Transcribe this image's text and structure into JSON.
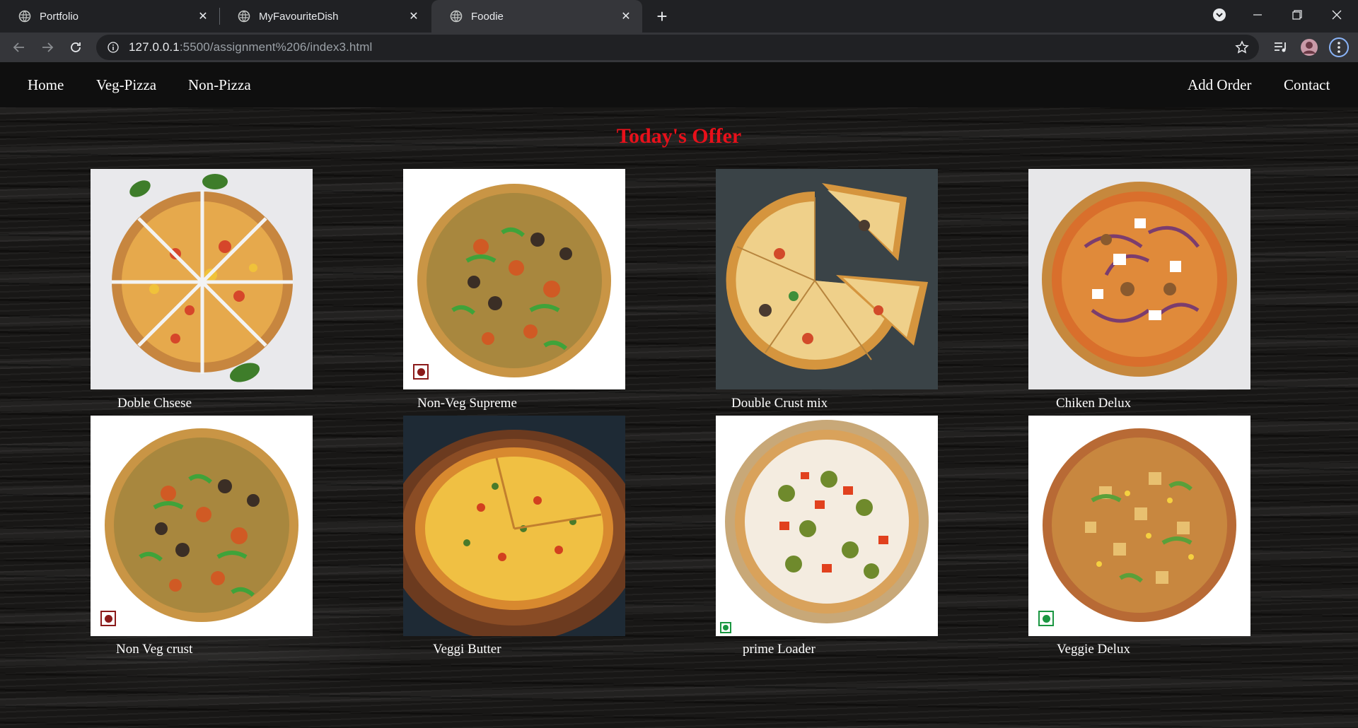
{
  "browser": {
    "tabs": [
      {
        "title": "Portfolio"
      },
      {
        "title": "MyFavouriteDish"
      },
      {
        "title": "Foodie"
      }
    ],
    "address": {
      "host": "127.0.0.1",
      "rest": ":5500/assignment%206/index3.html"
    }
  },
  "nav": {
    "left": [
      "Home",
      "Veg-Pizza",
      "Non-Pizza"
    ],
    "right": [
      "Add Order",
      "Contact"
    ]
  },
  "offer_title": "Today's Offer",
  "pizzas": [
    {
      "name": "Doble Chsese"
    },
    {
      "name": "Non-Veg Supreme",
      "badge": "non-veg"
    },
    {
      "name": "Double Crust mix"
    },
    {
      "name": "Chiken Delux"
    },
    {
      "name": "Non Veg crust",
      "badge": "non-veg"
    },
    {
      "name": "Veggi Butter"
    },
    {
      "name": "prime Loader",
      "badge": "veg"
    },
    {
      "name": "Veggie Delux",
      "badge": "veg"
    }
  ],
  "colors": {
    "title": "#e8101a",
    "veg": "#1a9641",
    "non_veg": "#8b1a1a",
    "nav_bg": "#0f0f0f"
  }
}
